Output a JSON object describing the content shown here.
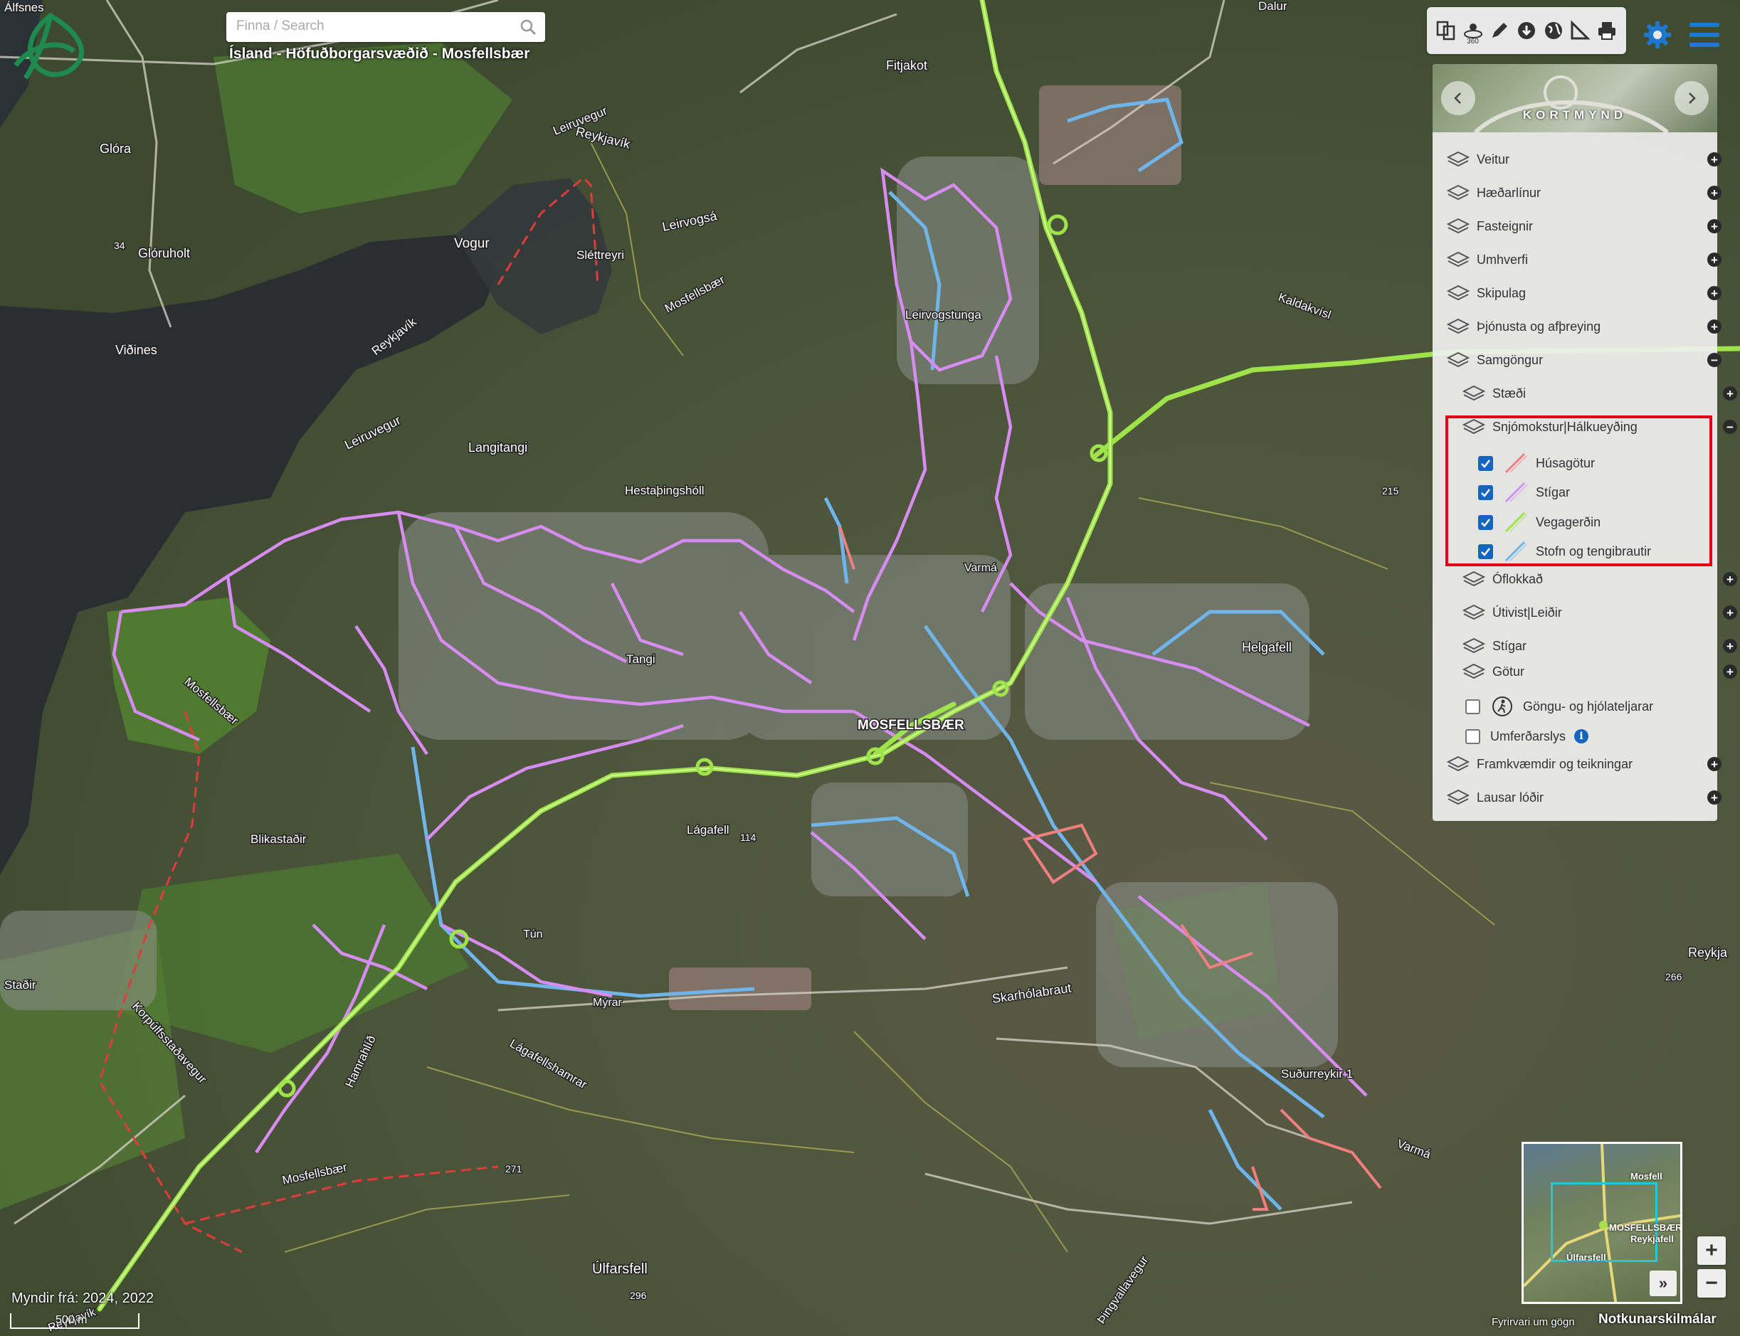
{
  "search": {
    "placeholder": "Finna / Search"
  },
  "breadcrumb": "Ísland - Höfuðborgarsvæðið - Mosfellsbær",
  "toolbar": {
    "icons": [
      "compare-icon",
      "360-view-icon",
      "pencil-icon",
      "download-icon",
      "globe-icon",
      "measure-icon",
      "print-icon"
    ],
    "badge_360": "360"
  },
  "basemap": {
    "label": "KORTMYND"
  },
  "layers": [
    {
      "label": "Veitur",
      "state": "+"
    },
    {
      "label": "Hæðarlínur",
      "state": "+"
    },
    {
      "label": "Fasteignir",
      "state": "+"
    },
    {
      "label": "Umhverfi",
      "state": "+"
    },
    {
      "label": "Skipulag",
      "state": "+"
    },
    {
      "label": "Þjónusta og afþreying",
      "state": "+"
    },
    {
      "label": "Samgöngur",
      "state": "−"
    },
    {
      "label": "Stæði",
      "state": "+"
    },
    {
      "label": "Snjómokstur|Hálkueyðing",
      "state": "−"
    },
    {
      "label": "Óflokkað",
      "state": "+"
    },
    {
      "label": "Útivist|Leiðir",
      "state": "+"
    },
    {
      "label": "Stígar",
      "state": "+"
    },
    {
      "label": "Götur",
      "state": "+"
    },
    {
      "label": "Framkvæmdir og teikningar",
      "state": "+"
    },
    {
      "label": "Lausar lóðir",
      "state": "+"
    }
  ],
  "snow_layers": [
    {
      "label": "Húsagötur",
      "checked": true,
      "color": "#f08080"
    },
    {
      "label": "Stígar",
      "checked": true,
      "color": "#d68cf0"
    },
    {
      "label": "Vegagerðin",
      "checked": true,
      "color": "#9ee34a"
    },
    {
      "label": "Stofn og tengibrautir",
      "checked": true,
      "color": "#6fb5ea"
    }
  ],
  "extra_layers": [
    {
      "label": "Göngu- og hjólateljarar",
      "checked": false,
      "icon": "walker-icon"
    },
    {
      "label": "Umferðarslys",
      "checked": false,
      "icon": "info-icon"
    }
  ],
  "info_glyph": "i",
  "map_labels": {
    "alfsnes": "Álfsnes",
    "dalur": "Dalur",
    "fitjakot": "Fitjakot",
    "glora": "Glóra",
    "gloruholt": "Glóruholt",
    "vogur": "Vogur",
    "leiruvegur1": "Leiruvegur",
    "reykjavik1": "Reykjavík",
    "leirvogsa": "Leirvogsá",
    "sletteyri": "Sléttreyri",
    "mosfellsbaer1": "Mosfellsbær",
    "vidines": "Viðines",
    "reykjavik2": "Reykjavík",
    "leiruvegur2": "Leiruvegur",
    "langitangi": "Langitangi",
    "hestathingsholl": "Hestaþingshóll",
    "leirvogstunga": "Leirvogstunga",
    "kaldakvisl": "Kaldakvísl",
    "helgafell": "Helgafell",
    "varma1": "Varmá",
    "mosfellsbaer_town": "MOSFELLSBÆR",
    "tangi": "Tangi",
    "mosfellsbaer2": "Mosfellsbær",
    "blikastadir": "Blikastaðir",
    "lagafell": "Lágafell",
    "skarholabraut": "Skarhólabraut",
    "korpulfsstadavegur": "Korpúlfsstaðavegur",
    "hamrahlid": "Hamrahlíð",
    "lagafellshamrar": "Lágafellshamrar",
    "mosfellsbaer3": "Mosfellsbær",
    "ulfarsfell": "Úlfarsfell",
    "sudurreykir": "Suðurreykir 1",
    "varma2": "Varmá",
    "thingvallavegur": "Þingvallavegur",
    "reykjavik3": "Reykjavík",
    "reykja": "Reykja",
    "myrar": "Mýrar",
    "tun": "Tún",
    "stadir": "Staðir",
    "e34": "34",
    "e215": "215",
    "e114": "114",
    "e271": "271",
    "e296": "296",
    "e266": "266"
  },
  "minimap": {
    "label1": "MOSFELLSBÆR",
    "label2": "Mosfell",
    "label3": "Úlfarsfell",
    "label4": "Reykjafell"
  },
  "minimap_toggle": "»",
  "zoom": {
    "in": "+",
    "out": "−"
  },
  "footer": {
    "imagery": "Myndir frá: 2024, 2022",
    "scale": "500 m",
    "disclaimer": "Fyrirvari um gögn",
    "terms": "Notkunarskilmálar"
  }
}
